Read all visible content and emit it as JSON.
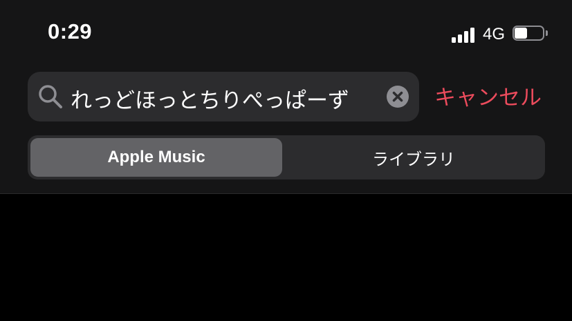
{
  "status_bar": {
    "time": "0:29",
    "network": "4G",
    "signal_bars": 4,
    "battery_level_percent": 45
  },
  "search": {
    "query": "れっどほっとちりぺっぱーず",
    "icon": "search-icon",
    "clear_icon": "clear-icon"
  },
  "cancel_label": "キャンセル",
  "segments": [
    {
      "label": "Apple Music",
      "selected": true
    },
    {
      "label": "ライブラリ",
      "selected": false
    }
  ],
  "colors": {
    "accent": "#eb4b5c",
    "panel": "#151516",
    "field": "#2c2c2e",
    "selected_segment": "#636366"
  }
}
